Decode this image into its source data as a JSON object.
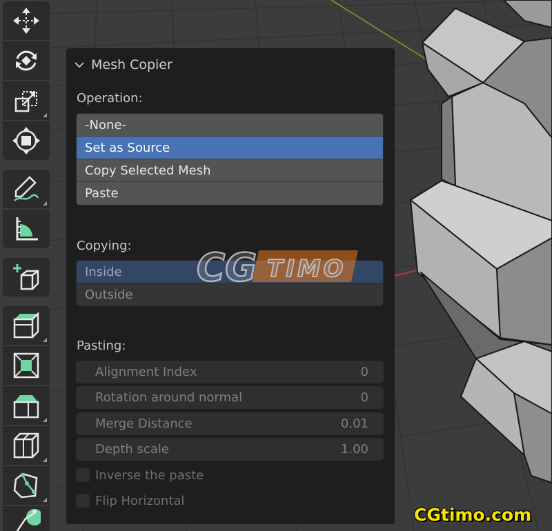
{
  "toolbar": {
    "tools": [
      {
        "name": "move-tool",
        "icon": "move-icon"
      },
      {
        "name": "rotate-tool",
        "icon": "rotate-icon"
      },
      {
        "name": "scale-tool",
        "icon": "scale-icon"
      },
      {
        "name": "transform-tool",
        "icon": "transform-icon"
      },
      {
        "name": "annotate-tool",
        "icon": "pencil-icon"
      },
      {
        "name": "measure-tool",
        "icon": "ruler-icon"
      },
      {
        "name": "add-cube-tool",
        "icon": "add-cube-icon"
      },
      {
        "name": "extrude-tool",
        "icon": "extrude-icon"
      },
      {
        "name": "inset-tool",
        "icon": "inset-icon"
      },
      {
        "name": "bevel-tool",
        "icon": "bevel-icon"
      },
      {
        "name": "loop-cut-tool",
        "icon": "loop-cut-icon"
      },
      {
        "name": "knife-tool",
        "icon": "knife-icon"
      },
      {
        "name": "poly-build-tool",
        "icon": "poly-build-icon"
      }
    ],
    "accent_color": "#71d6a4"
  },
  "panel": {
    "title": "Mesh Copier",
    "operation": {
      "label": "Operation:",
      "options": [
        "-None-",
        "Set as Source",
        "Copy Selected Mesh",
        "Paste"
      ],
      "selected": "Set as Source"
    },
    "copying": {
      "label": "Copying:",
      "options": [
        "Inside",
        "Outside"
      ],
      "selected": "Inside"
    },
    "pasting": {
      "label": "Pasting:",
      "fields": [
        {
          "label": "Alignment Index",
          "value": "0"
        },
        {
          "label": "Rotation around normal",
          "value": "0"
        },
        {
          "label": "Merge Distance",
          "value": "0.01"
        },
        {
          "label": "Depth scale",
          "value": "1.00"
        }
      ],
      "checkboxes": [
        {
          "label": "Inverse the paste",
          "checked": false
        },
        {
          "label": "Flip Horizontal",
          "checked": false
        }
      ]
    }
  },
  "watermark": {
    "center_text_1": "CG",
    "center_text_2": "TIMO",
    "corner_text": "CGtimo.com"
  },
  "colors": {
    "selection": "#4772b3",
    "panel_bg": "#1e1e1e",
    "viewport_bg": "#3b3b3b",
    "watermark_yellow": "#f5e600",
    "watermark_orange": "#e8761e"
  }
}
